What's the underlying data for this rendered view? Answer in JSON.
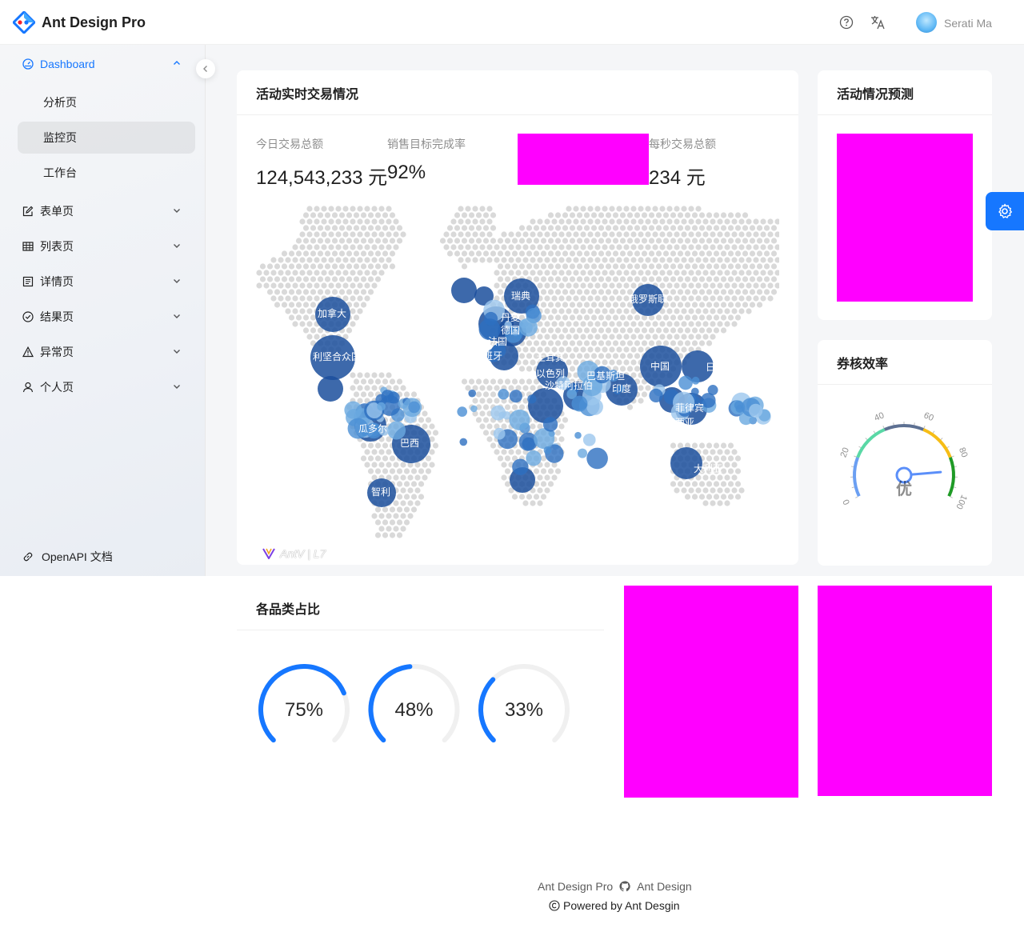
{
  "header": {
    "app_title": "Ant Design Pro",
    "user_name": "Serati Ma",
    "icons": [
      "question-circle-icon",
      "translation-icon"
    ]
  },
  "sidebar": {
    "dashboard": "Dashboard",
    "sub_items": [
      "分析页",
      "监控页",
      "工作台"
    ],
    "active_sub": "监控页",
    "items": [
      {
        "label": "表单页",
        "icon": "form-icon"
      },
      {
        "label": "列表页",
        "icon": "table-icon"
      },
      {
        "label": "详情页",
        "icon": "profile-icon"
      },
      {
        "label": "结果页",
        "icon": "check-circle-icon"
      },
      {
        "label": "异常页",
        "icon": "warning-icon"
      },
      {
        "label": "个人页",
        "icon": "user-icon"
      }
    ],
    "openapi": "OpenAPI 文档"
  },
  "realtime": {
    "title": "活动实时交易情况",
    "stats": [
      {
        "label": "今日交易总额",
        "value": "124,543,233 元"
      },
      {
        "label": "销售目标完成率",
        "value": "92%"
      },
      {
        "label": "每秒交易总额",
        "value": "234 元"
      }
    ],
    "map_watermark": "AntV | L7",
    "map_labels": [
      "加拿大",
      "利坚合众国",
      "瑞典",
      "丹麦",
      "德国",
      "法国",
      "西班牙",
      "土耳其",
      "以色列",
      "沙特阿拉伯",
      "巴基斯坦",
      "印度",
      "中国",
      "日本",
      "俄罗斯联",
      "菲律宾",
      "马来西亚",
      "瓜多尔",
      "巴西",
      "智利",
      "大利亚"
    ]
  },
  "forecast": {
    "title": "活动情况预测"
  },
  "efficiency": {
    "title": "券核效率",
    "gauge_value": 87,
    "gauge_text": "优",
    "ticks": [
      "0",
      "20",
      "40",
      "60",
      "80",
      "100"
    ]
  },
  "category": {
    "title": "各品类占比",
    "rings": [
      {
        "value": 75,
        "label": "75%"
      },
      {
        "value": 48,
        "label": "48%"
      },
      {
        "value": 33,
        "label": "33%"
      }
    ]
  },
  "footer": {
    "link1": "Ant Design Pro",
    "link2": "Ant Design",
    "copyright": "Powered by Ant Desgin"
  },
  "colors": {
    "primary": "#1677ff",
    "placeholder": "#ff00ff"
  }
}
